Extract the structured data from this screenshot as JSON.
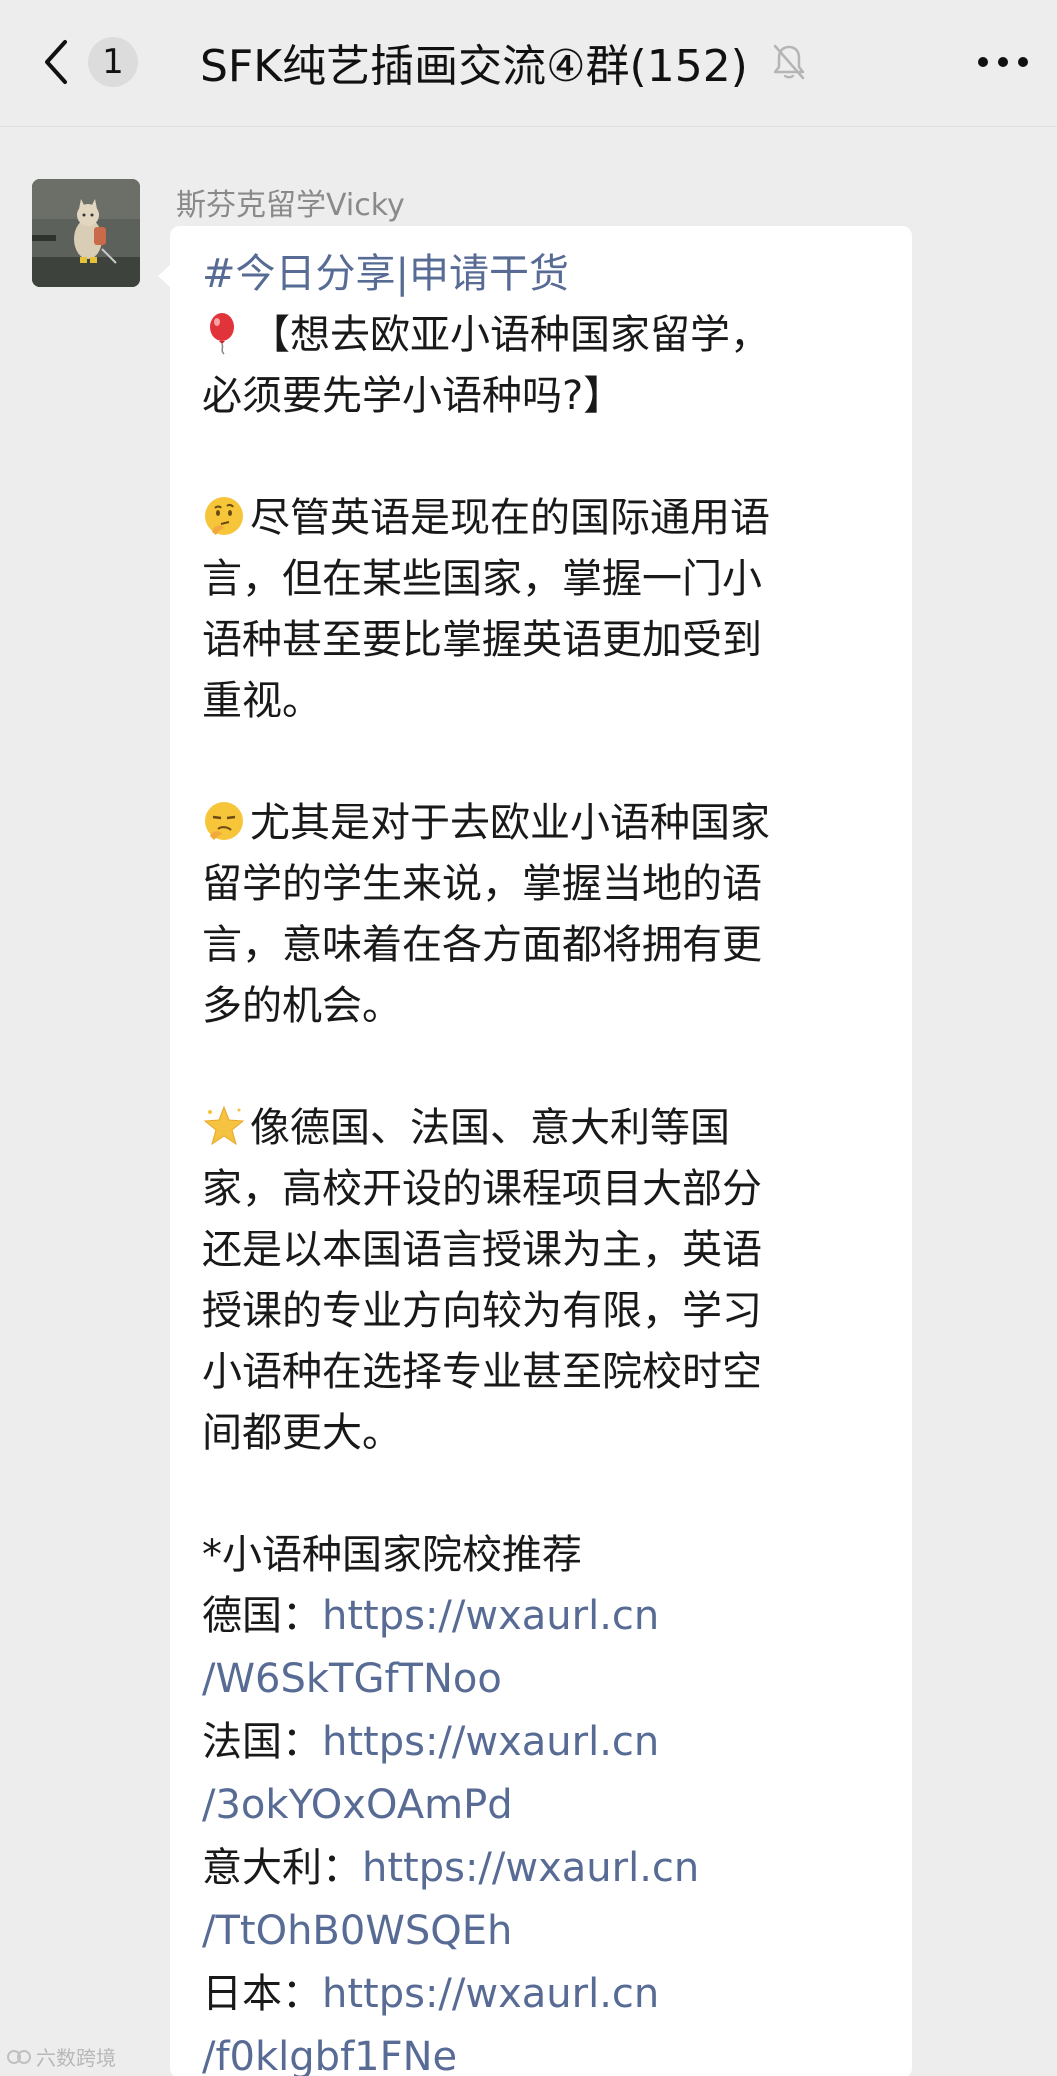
{
  "header": {
    "back_icon": "chevron-left-icon",
    "unread_count": "1",
    "title": "SFK纯艺插画交流④群(152)",
    "mute_icon": "bell-muted-icon",
    "more_icon": "more-dots-icon"
  },
  "message": {
    "sender": "斯芬克留学Vicky",
    "avatar_icon": "cat-avatar",
    "hashtag": "#今日分享|申请干货",
    "title_line1": "【想去欧亚小语种国家留学，",
    "title_line2": "必须要先学小语种吗?】",
    "p1_line1": "尽管英语是现在的国际通用语",
    "p1_line2": "言，但在某些国家，掌握一门小",
    "p1_line3": "语种甚至要比掌握英语更加受到",
    "p1_line4": "重视。",
    "p2_line1": "尤其是对于去欧业小语种国家",
    "p2_line2": "留学的学生来说，掌握当地的语",
    "p2_line3": "言，意味着在各方面都将拥有更",
    "p2_line4": "多的机会。",
    "p3_line1": "像德国、法国、意大利等国",
    "p3_line2": "家，高校开设的课程项目大部分",
    "p3_line3": "还是以本国语言授课为主，英语",
    "p3_line4": "授课的专业方向较为有限，学习",
    "p3_line5": "小语种在选择专业甚至院校时空",
    "p3_line6": "间都更大。",
    "rec_title": "*小语种国家院校推荐",
    "links": [
      {
        "country": "德国：",
        "url_part1": "https://wxaurl.cn",
        "url_part2": "/W6SkTGfTNoo"
      },
      {
        "country": "法国：",
        "url_part1": "https://wxaurl.cn",
        "url_part2": "/3okYOxOAmPd"
      },
      {
        "country": "意大利：",
        "url_part1": "https://wxaurl.cn",
        "url_part2": "/TtOhB0WSQEh"
      },
      {
        "country": "日本：",
        "url_part1": "https://wxaurl.cn",
        "url_part2": "/f0klgbf1FNe"
      }
    ],
    "emoji_icons": [
      "balloon-icon",
      "thinking-face-icon",
      "squint-face-icon",
      "star-icon"
    ]
  },
  "watermark": "六数跨境",
  "colors": {
    "background": "#ededed",
    "bubble": "#ffffff",
    "link": "#576b95",
    "text": "#191919",
    "sender": "#8a8a8a"
  }
}
